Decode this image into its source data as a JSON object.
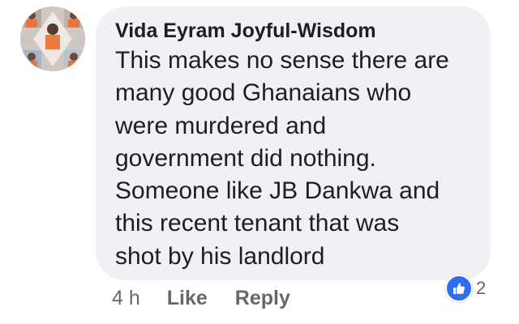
{
  "comment": {
    "author": "Vida Eyram Joyful-Wisdom",
    "lines": [
      "This makes no sense there are",
      "many good Ghanaians who",
      "were murdered and",
      "government did nothing.",
      "Someone like JB Dankwa and",
      "this recent tenant that was",
      "shot by his landlord"
    ],
    "timestamp": "4 h",
    "like_label": "Like",
    "reply_label": "Reply",
    "reaction_count": "2",
    "reaction_icon": "thumbs-up-icon"
  },
  "colors": {
    "bubble": "#f0f1f5",
    "text": "#1c1e21",
    "meta": "#65676b",
    "like_blue": "#2e6ff2"
  }
}
